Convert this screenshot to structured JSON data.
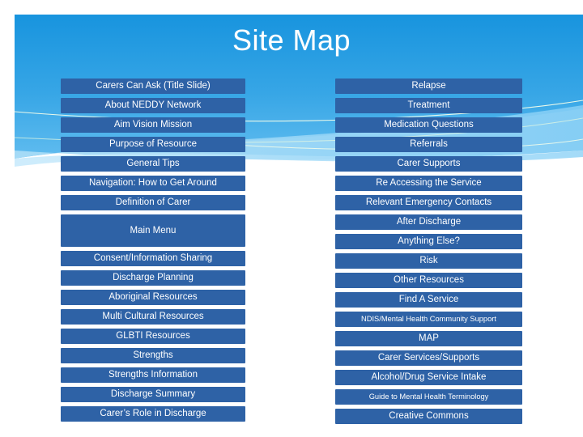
{
  "slide": {
    "title": "Site Map",
    "background_color": "#FFFFFF",
    "banner_gradient_top": "#1F9AE0",
    "banner_gradient_bottom": "#5BB8EE",
    "box_color": "#2E62A6",
    "box_text_color": "#FFFFFF"
  },
  "left_column": {
    "items": [
      {
        "label": "Carers Can Ask (Title Slide)",
        "size": "normal",
        "height": "normal"
      },
      {
        "label": "About NEDDY Network",
        "size": "normal",
        "height": "normal"
      },
      {
        "label": "Aim Vision Mission",
        "size": "normal",
        "height": "normal"
      },
      {
        "label": "Purpose of Resource",
        "size": "normal",
        "height": "normal"
      },
      {
        "label": "General Tips",
        "size": "normal",
        "height": "normal"
      },
      {
        "label": "Navigation: How to Get Around",
        "size": "normal",
        "height": "normal"
      },
      {
        "label": "Definition of Carer",
        "size": "normal",
        "height": "normal"
      },
      {
        "label": "Main Menu",
        "size": "normal",
        "height": "tall"
      },
      {
        "label": "Consent/Information Sharing",
        "size": "normal",
        "height": "normal"
      },
      {
        "label": "Discharge Planning",
        "size": "normal",
        "height": "normal"
      },
      {
        "label": "Aboriginal Resources",
        "size": "normal",
        "height": "normal"
      },
      {
        "label": "Multi Cultural Resources",
        "size": "normal",
        "height": "normal"
      },
      {
        "label": "GLBTI Resources",
        "size": "normal",
        "height": "normal"
      },
      {
        "label": "Strengths",
        "size": "normal",
        "height": "normal"
      },
      {
        "label": "Strengths Information",
        "size": "normal",
        "height": "normal"
      },
      {
        "label": "Discharge Summary",
        "size": "normal",
        "height": "normal"
      },
      {
        "label": "Carer’s Role in Discharge",
        "size": "normal",
        "height": "normal"
      }
    ]
  },
  "right_column": {
    "items": [
      {
        "label": "Relapse",
        "size": "normal",
        "height": "normal"
      },
      {
        "label": "Treatment",
        "size": "normal",
        "height": "normal"
      },
      {
        "label": "Medication Questions",
        "size": "normal",
        "height": "normal"
      },
      {
        "label": "Referrals",
        "size": "normal",
        "height": "normal"
      },
      {
        "label": "Carer Supports",
        "size": "normal",
        "height": "normal"
      },
      {
        "label": "Re Accessing the Service",
        "size": "normal",
        "height": "normal"
      },
      {
        "label": "Relevant Emergency Contacts",
        "size": "normal",
        "height": "normal"
      },
      {
        "label": "After Discharge",
        "size": "normal",
        "height": "normal"
      },
      {
        "label": "Anything Else?",
        "size": "normal",
        "height": "normal"
      },
      {
        "label": "Risk",
        "size": "normal",
        "height": "normal"
      },
      {
        "label": "Other Resources",
        "size": "normal",
        "height": "normal"
      },
      {
        "label": "Find A Service",
        "size": "normal",
        "height": "normal"
      },
      {
        "label": "NDIS/Mental Health Community Support",
        "size": "small",
        "height": "normal"
      },
      {
        "label": "MAP",
        "size": "normal",
        "height": "normal"
      },
      {
        "label": "Carer Services/Supports",
        "size": "normal",
        "height": "normal"
      },
      {
        "label": "Alcohol/Drug Service Intake",
        "size": "normal",
        "height": "normal"
      },
      {
        "label": "Guide to Mental Health Terminology",
        "size": "small",
        "height": "normal"
      },
      {
        "label": "Creative Commons",
        "size": "normal",
        "height": "normal"
      }
    ]
  }
}
